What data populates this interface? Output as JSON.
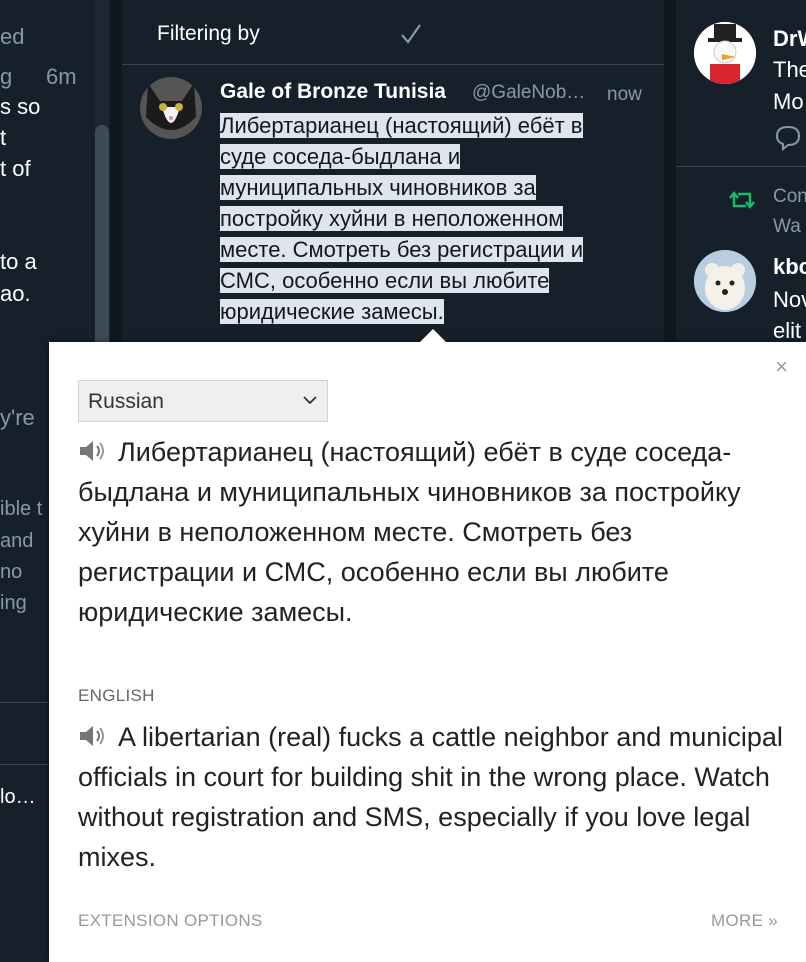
{
  "left_column": {
    "fragments": [
      "ed",
      "g",
      "6m",
      "s so",
      "t",
      "t of",
      "to a",
      "ao.",
      "y're",
      "ible t",
      "and",
      "no",
      "ing",
      "lo…"
    ]
  },
  "filter_column": {
    "header_label": "Filtering by",
    "tweet": {
      "name": "Gale of Bronze Tunisia",
      "handle": "@GaleNob…",
      "time": "now",
      "text_lines": [
        "Либертарианец (настоящий) ебёт в",
        "суде соседа-быдлана и",
        "муниципальных чиновников за",
        "постройку хуйни в неположенном",
        "месте. Смотреть без регистрации и",
        "СМС, особенно если вы любите",
        "юридические замесы."
      ]
    }
  },
  "right_column": {
    "item1": {
      "name": "DrW",
      "line1": "The",
      "line2": "Mo"
    },
    "retweet_label": "Con",
    "retweet_label2": "Wa",
    "item2": {
      "name": "kbc",
      "line1": "Nov",
      "line2": "elit"
    }
  },
  "popup": {
    "language_select": {
      "selected": "Russian"
    },
    "source_text": "Либертарианец (настоящий) ебёт в суде соседа-быдлана и муниципальных чиновников за постройку хуйни в неположенном месте. Смотреть без регистрации и СМС, особенно если вы любите юридические замесы.",
    "target_language_label": "ENGLISH",
    "translation_text": "A libertarian (real) fucks a cattle neighbor and municipal officials in court for building shit in the wrong place. Watch without registration and SMS, especially if you love legal mixes.",
    "footer_options": "EXTENSION OPTIONS",
    "footer_more": "MORE »",
    "close_glyph": "×"
  },
  "colors": {
    "background": "#15202b",
    "highlight": "#dfe5ee",
    "retweet_green": "#17bf63"
  }
}
